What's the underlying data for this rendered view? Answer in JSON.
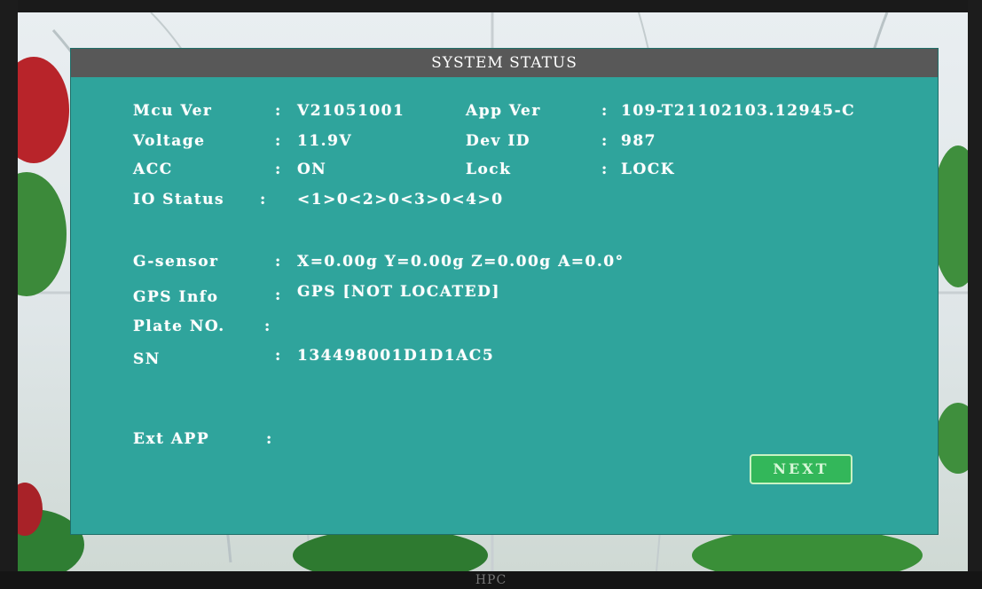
{
  "monitor": {
    "brand": "HPC"
  },
  "dialog": {
    "title": "SYSTEM STATUS",
    "fields": {
      "mcu_ver": {
        "label": "Mcu Ver",
        "value": "V21051001"
      },
      "app_ver": {
        "label": "App Ver",
        "value": "109-T21102103.12945-C"
      },
      "voltage": {
        "label": "Voltage",
        "value": "11.9V"
      },
      "dev_id": {
        "label": "Dev ID",
        "value": "987"
      },
      "acc": {
        "label": "ACC",
        "value": "ON"
      },
      "lock": {
        "label": "Lock",
        "value": "LOCK"
      },
      "io_status": {
        "label": "IO Status",
        "value": "<1>0<2>0<3>0<4>0"
      },
      "g_sensor": {
        "label": "G-sensor",
        "value": "X=0.00g Y=0.00g Z=0.00g A=0.0°"
      },
      "gps_info": {
        "label": "GPS Info",
        "value": "GPS [NOT LOCATED]"
      },
      "plate_no": {
        "label": "Plate NO.",
        "value": ""
      },
      "sn": {
        "label": "SN",
        "value": "134498001D1D1AC5"
      },
      "ext_app": {
        "label": "Ext APP",
        "value": ""
      }
    },
    "separator": ":",
    "next_label": "NEXT"
  },
  "colors": {
    "dialog_bg": "#2fa49c",
    "title_bar_bg": "#585858",
    "button_bg": "#33b75a",
    "text": "#ffffff"
  }
}
